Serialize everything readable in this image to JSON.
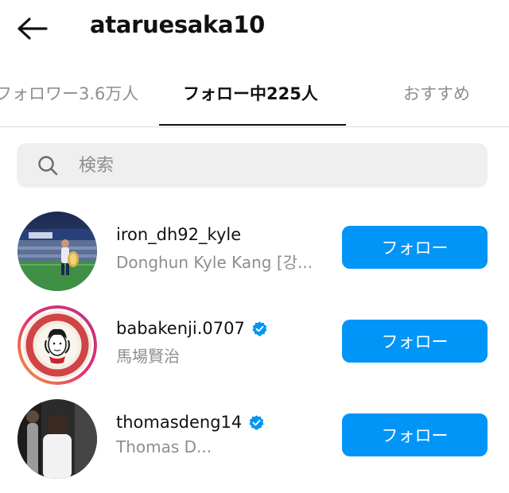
{
  "header": {
    "title": "ataruesaka10",
    "back_icon": "arrow-left-icon"
  },
  "tabs": [
    {
      "label": "フォロワー3.6万人",
      "active": false
    },
    {
      "label": "フォロー中225人",
      "active": true
    },
    {
      "label": "おすすめ",
      "active": false
    }
  ],
  "search": {
    "placeholder": "検索",
    "value": "",
    "icon": "search-icon"
  },
  "users": [
    {
      "username": "iron_dh92_kyle",
      "full_name": "Donghun Kyle Kang [강...",
      "verified": false,
      "button_label": "フォロー"
    },
    {
      "username": "babakenji.0707",
      "full_name": "馬場賢治",
      "verified": true,
      "button_label": "フォロー"
    },
    {
      "username": "thomasdeng14",
      "full_name": "Thomas D...",
      "verified": true,
      "button_label": "フォロー"
    }
  ],
  "colors": {
    "accent": "#0095f6",
    "verified": "#0095f6",
    "muted_text": "#8e8e8e",
    "search_bg": "#efefef"
  }
}
